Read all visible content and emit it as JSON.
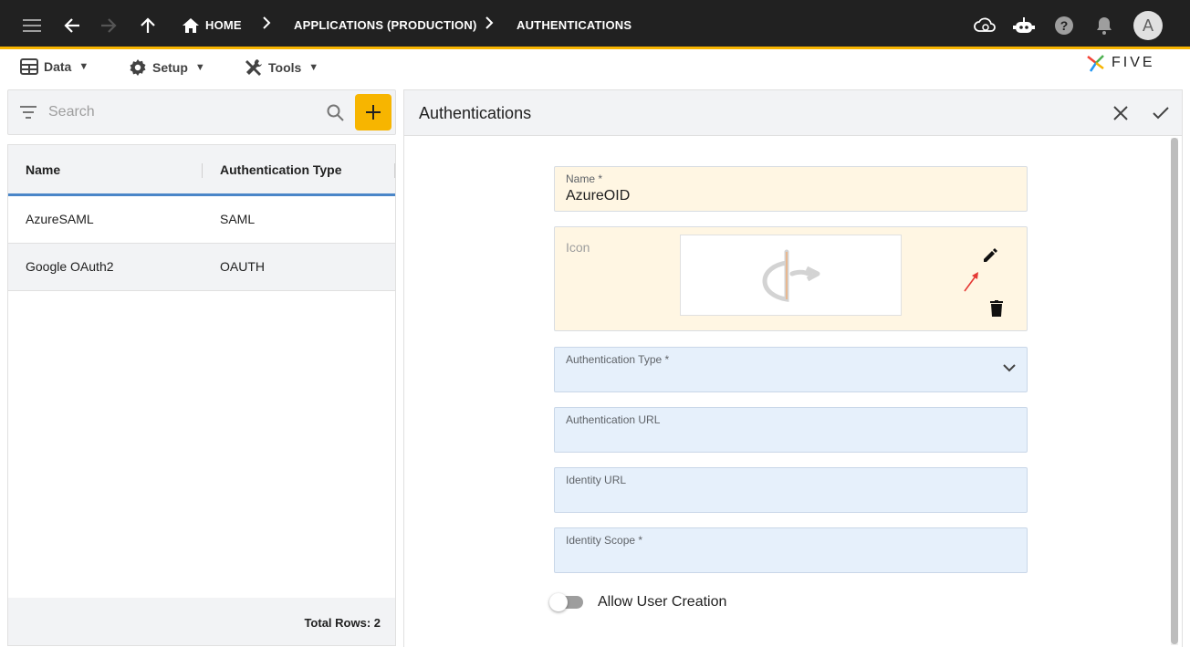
{
  "breadcrumb": {
    "home": "HOME",
    "applications": "APPLICATIONS (PRODUCTION)",
    "current": "AUTHENTICATIONS"
  },
  "user": {
    "avatar_initial": "A"
  },
  "menu": {
    "data": "Data",
    "setup": "Setup",
    "tools": "Tools",
    "caret": "▼"
  },
  "brand": {
    "logo_text": "FIVE"
  },
  "search": {
    "placeholder": "Search"
  },
  "list": {
    "columns": [
      "Name",
      "Authentication Type"
    ],
    "rows": [
      {
        "name": "AzureSAML",
        "type": "SAML"
      },
      {
        "name": "Google OAuth2",
        "type": "OAUTH"
      }
    ],
    "total_rows": "Total Rows: 2"
  },
  "form": {
    "title": "Authentications",
    "name_label": "Name *",
    "name_value": "AzureOID",
    "icon_label": "Icon",
    "auth_type_label": "Authentication Type *",
    "auth_type_value": "",
    "auth_url_label": "Authentication URL",
    "auth_url_value": "",
    "identity_url_label": "Identity URL",
    "identity_url_value": "",
    "identity_scope_label": "Identity Scope *",
    "identity_scope_value": "",
    "allow_user_creation_label": "Allow User Creation",
    "allow_user_creation_on": false
  },
  "colors": {
    "appbar": "#212121",
    "accent": "#f7b500",
    "header_underline": "#4a86c8",
    "required_field_bg": "#fff6e3",
    "field_bg": "#e6f0fb"
  }
}
